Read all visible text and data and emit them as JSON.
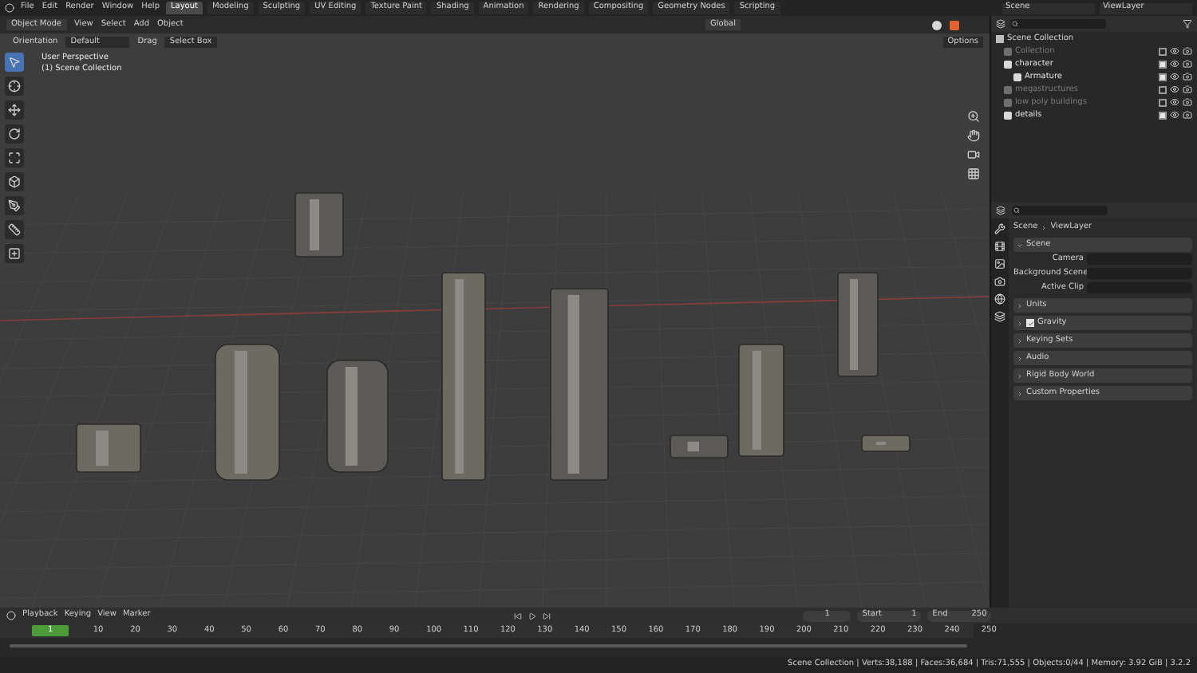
{
  "menu": [
    "File",
    "Edit",
    "Render",
    "Window",
    "Help"
  ],
  "workspaces": [
    {
      "label": "Layout",
      "selected": true
    },
    {
      "label": "Modeling",
      "selected": false
    },
    {
      "label": "Sculpting",
      "selected": false
    },
    {
      "label": "UV Editing",
      "selected": false
    },
    {
      "label": "Texture Paint",
      "selected": false
    },
    {
      "label": "Shading",
      "selected": false
    },
    {
      "label": "Animation",
      "selected": false
    },
    {
      "label": "Rendering",
      "selected": false
    },
    {
      "label": "Compositing",
      "selected": false
    },
    {
      "label": "Geometry Nodes",
      "selected": false
    },
    {
      "label": "Scripting",
      "selected": false
    }
  ],
  "scene": {
    "value": "Scene"
  },
  "view_layer": {
    "value": "ViewLayer"
  },
  "viewport": {
    "mode": "Object Mode",
    "menus": [
      "View",
      "Select",
      "Add",
      "Object"
    ],
    "orientation_global": "Global",
    "options": "Options",
    "tool_settings": {
      "orientation_label": "Orientation",
      "orientation": "Default",
      "drag_label": "Drag",
      "drag": "Select Box"
    },
    "info": [
      "User Perspective",
      "(1) Scene Collection"
    ],
    "tools": [
      {
        "kind": "select",
        "selected": true
      },
      {
        "kind": "cursor",
        "selected": false
      },
      {
        "kind": "move",
        "selected": false
      },
      {
        "kind": "rotate",
        "selected": false
      },
      {
        "kind": "scale",
        "selected": false
      },
      {
        "kind": "transform",
        "selected": false
      },
      {
        "kind": "annotate",
        "selected": false
      },
      {
        "kind": "measure",
        "selected": false
      },
      {
        "kind": "add",
        "selected": false
      }
    ]
  },
  "outliner": {
    "root": "Scene Collection",
    "items": [
      {
        "label": "Collection",
        "checked": false
      },
      {
        "label": "character",
        "checked": true,
        "children": [
          {
            "label": "Armature",
            "checked": true
          }
        ]
      },
      {
        "label": "megastructures",
        "checked": false
      },
      {
        "label": "low poly buildings",
        "checked": false
      },
      {
        "label": "details",
        "checked": true
      }
    ]
  },
  "properties": {
    "breadcrumb": [
      "Scene",
      "ViewLayer"
    ],
    "panels": [
      {
        "label": "Scene",
        "expanded": true,
        "fields": [
          "Camera",
          "Background Scene",
          "Active Clip"
        ]
      },
      {
        "label": "Units",
        "expanded": false
      },
      {
        "label": "Gravity",
        "expanded": false,
        "checked": true
      },
      {
        "label": "Keying Sets",
        "expanded": false
      },
      {
        "label": "Audio",
        "expanded": false
      },
      {
        "label": "Rigid Body World",
        "expanded": false
      },
      {
        "label": "Custom Properties",
        "expanded": false
      }
    ]
  },
  "timeline": {
    "menus": [
      "Playback",
      "Keying",
      "View",
      "Marker"
    ],
    "current_frame": "1",
    "start_label": "Start",
    "start": "1",
    "end_label": "End",
    "end": "250",
    "ruler": [
      "1",
      "10",
      "20",
      "30",
      "40",
      "50",
      "60",
      "70",
      "80",
      "90",
      "100",
      "110",
      "120",
      "130",
      "140",
      "150",
      "160",
      "170",
      "180",
      "190",
      "200",
      "210",
      "220",
      "230",
      "240",
      "250"
    ]
  },
  "status_bar": "Scene Collection | Verts:38,188 | Faces:36,684 | Tris:71,555 | Objects:0/44 | Memory: 3.92 GiB | 3.2.2"
}
